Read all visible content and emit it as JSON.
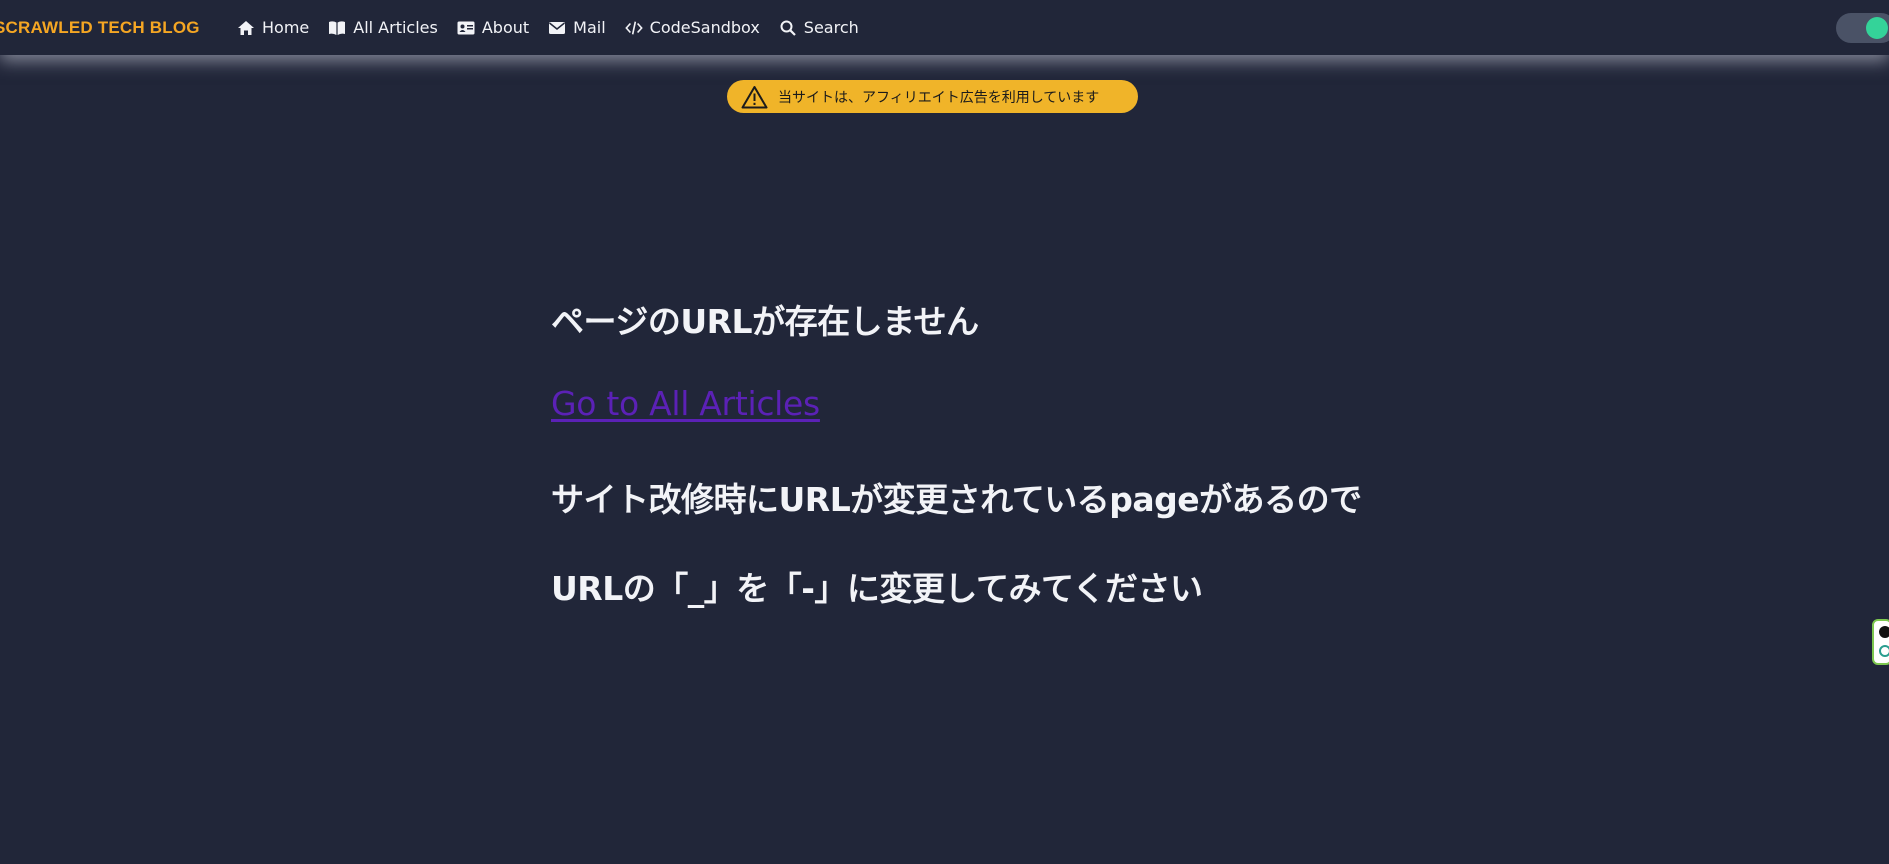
{
  "header": {
    "brand": "SCRAWLED TECH BLOG",
    "nav": [
      {
        "label": "Home",
        "icon": "home-icon"
      },
      {
        "label": "All Articles",
        "icon": "book-icon"
      },
      {
        "label": "About",
        "icon": "id-card-icon"
      },
      {
        "label": "Mail",
        "icon": "envelope-icon"
      },
      {
        "label": "CodeSandbox",
        "icon": "code-icon"
      },
      {
        "label": "Search",
        "icon": "search-icon"
      }
    ],
    "theme_toggle_on": true
  },
  "notice": {
    "text": "当サイトは、アフィリエイト広告を利用しています",
    "icon": "warning-icon",
    "color": "#f0b429"
  },
  "main": {
    "heading": "ページのURLが存在しません",
    "link": "Go to All Articles",
    "message1": "サイト改修時にURLが変更されているpageがあるので",
    "message2": "URLの「_」を「-」に変更してみてください"
  },
  "colors": {
    "background": "#212639",
    "brand": "#f5a623",
    "link": "#5b21b6",
    "toggle_knob": "#34d399"
  }
}
